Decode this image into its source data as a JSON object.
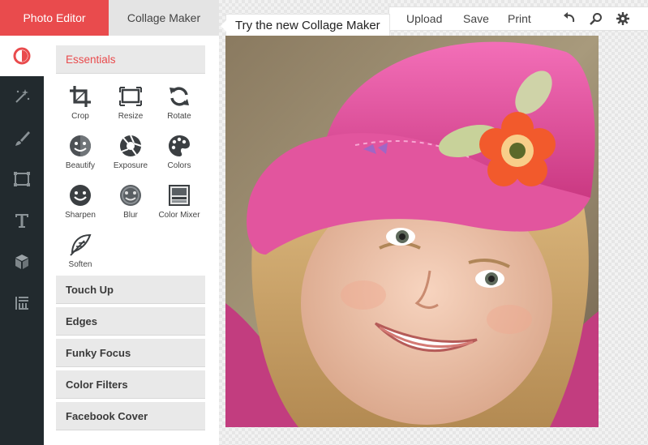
{
  "tabs": {
    "photo_editor": "Photo Editor",
    "collage_maker": "Collage Maker"
  },
  "colors": {
    "accent": "#e94b4d",
    "rail": "#222a2e",
    "section_bg": "#e9e9e9"
  },
  "rail": [
    {
      "icon": "color-wheel-icon",
      "active": true
    },
    {
      "icon": "magic-wand-icon",
      "active": false
    },
    {
      "icon": "brush-icon",
      "active": false
    },
    {
      "icon": "frame-icon",
      "active": false
    },
    {
      "icon": "text-icon",
      "active": false
    },
    {
      "icon": "cube-icon",
      "active": false
    },
    {
      "icon": "texture-icon",
      "active": false
    }
  ],
  "panel": {
    "essentials": "Essentials",
    "tools": [
      {
        "label": "Crop",
        "icon": "crop-icon"
      },
      {
        "label": "Resize",
        "icon": "resize-icon"
      },
      {
        "label": "Rotate",
        "icon": "rotate-icon"
      },
      {
        "label": "Beautify",
        "icon": "beautify-icon"
      },
      {
        "label": "Exposure",
        "icon": "exposure-icon"
      },
      {
        "label": "Colors",
        "icon": "palette-icon"
      },
      {
        "label": "Sharpen",
        "icon": "sharpen-icon"
      },
      {
        "label": "Blur",
        "icon": "blur-icon"
      },
      {
        "label": "Color Mixer",
        "icon": "color-mixer-icon"
      },
      {
        "label": "Soften",
        "icon": "feather-icon"
      }
    ],
    "sections": [
      "Touch Up",
      "Edges",
      "Funky Focus",
      "Color Filters",
      "Facebook Cover"
    ]
  },
  "toolbar": {
    "tooltip": "Try the new Collage Maker",
    "upload": "Upload",
    "save": "Save",
    "print": "Print",
    "icons": [
      "undo-icon",
      "zoom-icon",
      "settings-icon"
    ]
  }
}
